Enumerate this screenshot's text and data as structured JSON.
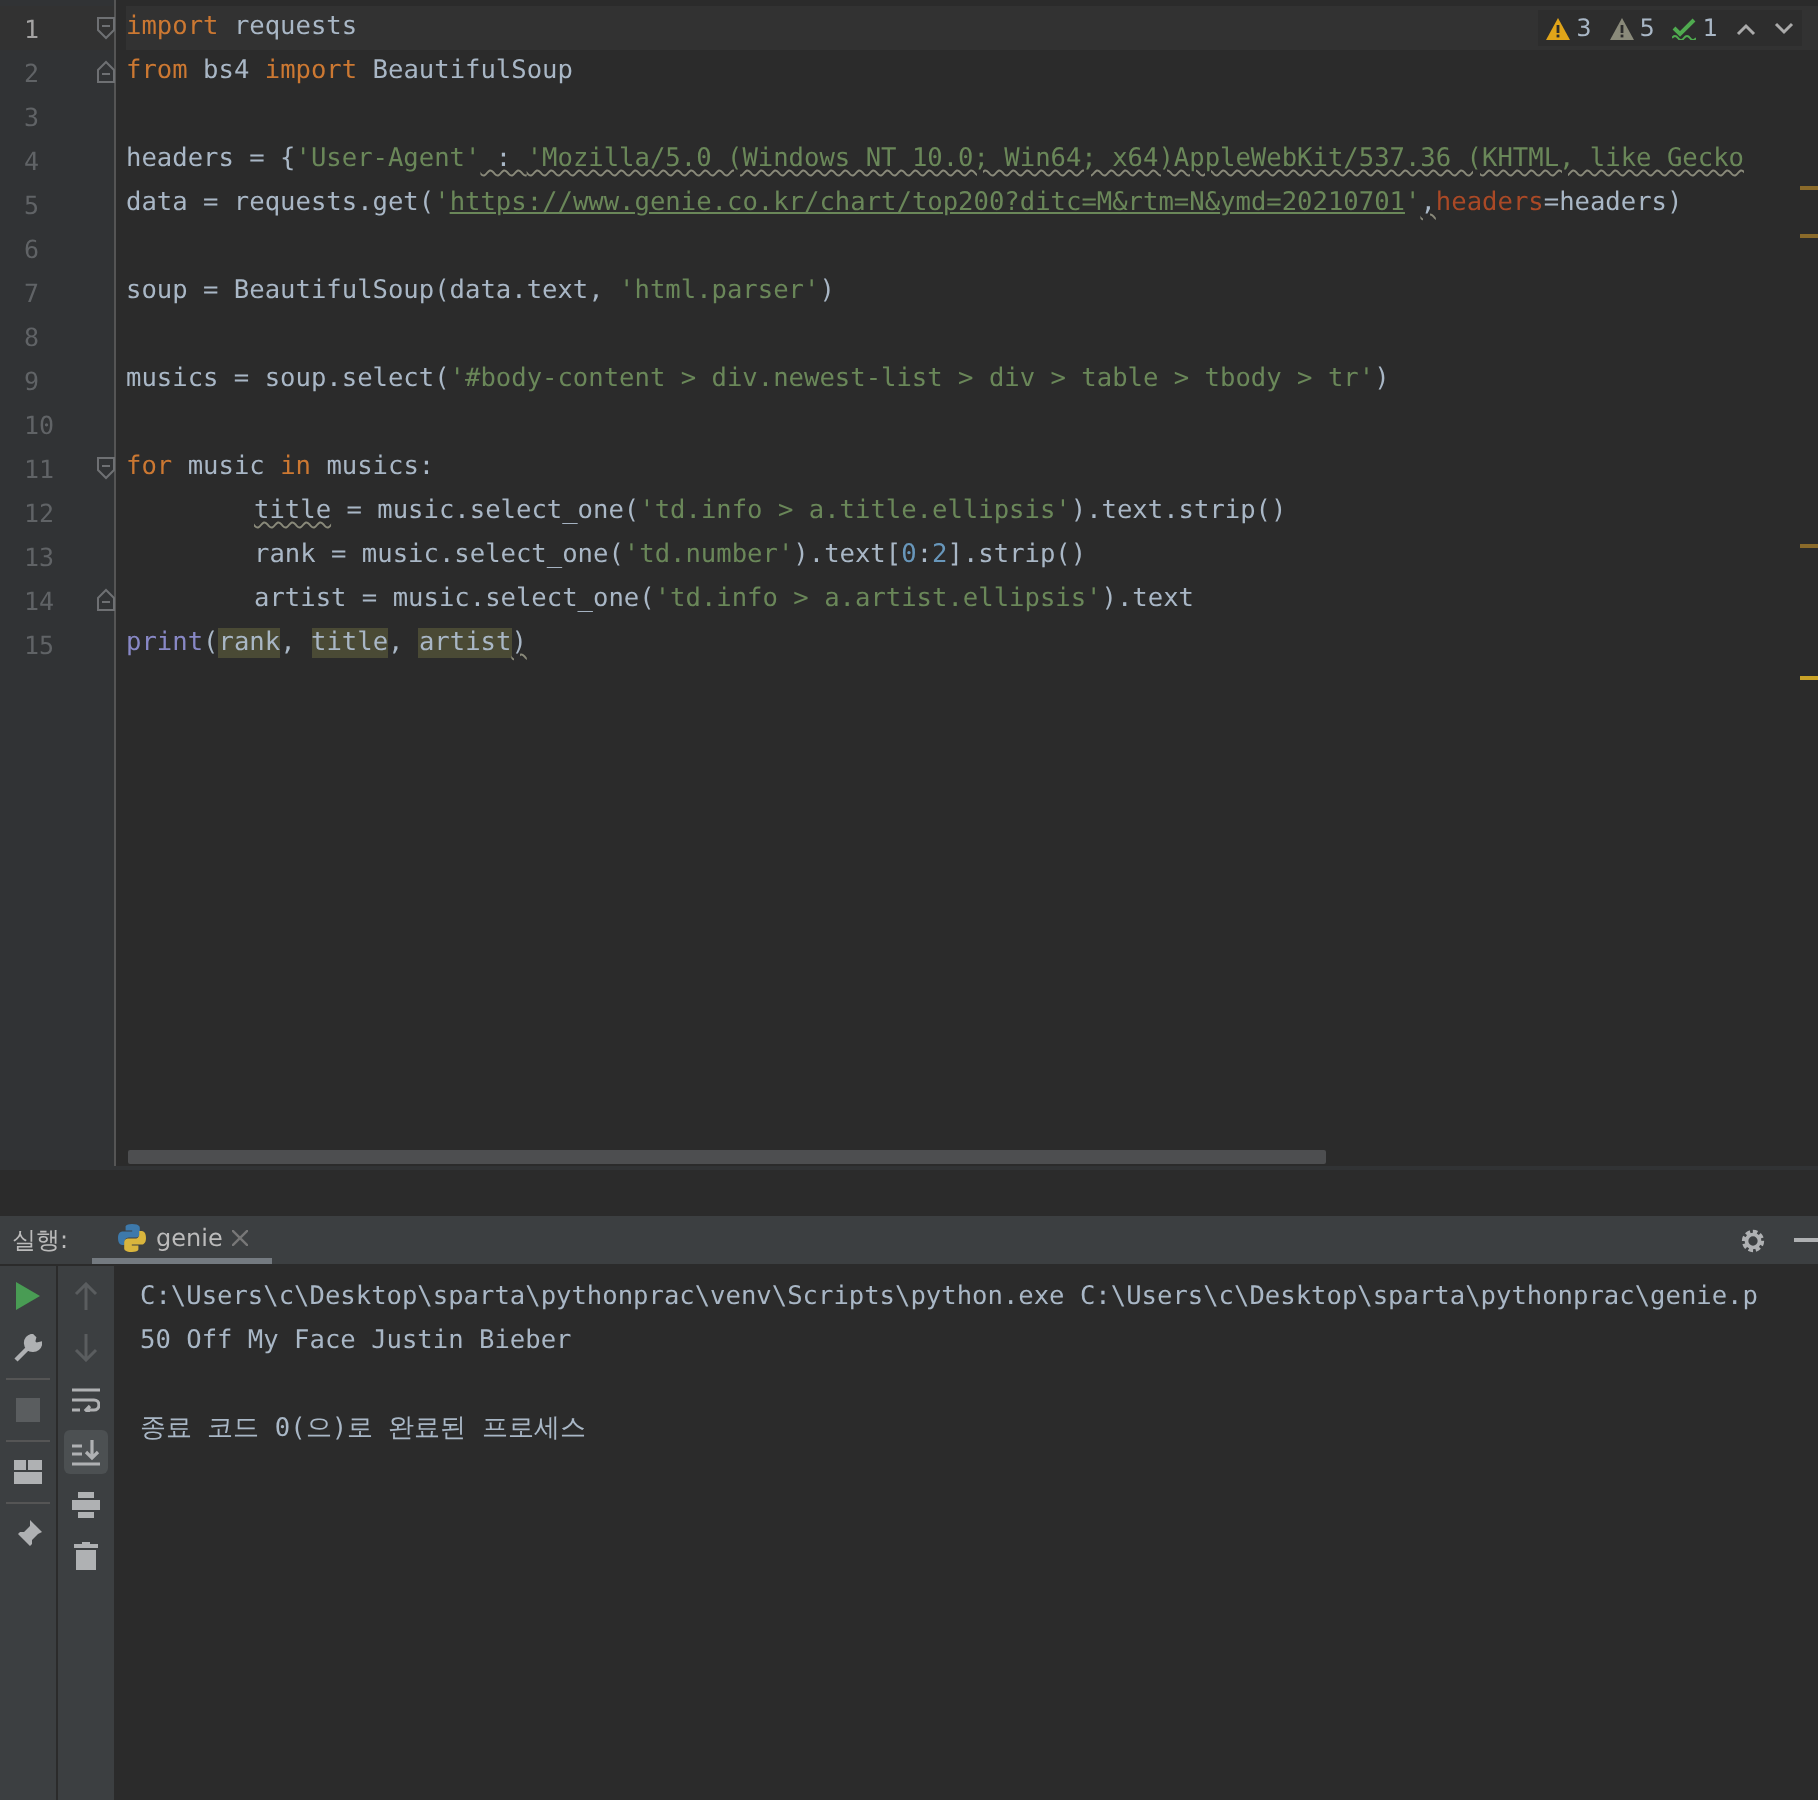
{
  "inspections": [
    {
      "kind": "warning",
      "count": "3"
    },
    {
      "kind": "weak-warning",
      "count": "5"
    },
    {
      "kind": "typo",
      "count": "1"
    }
  ],
  "editor": {
    "lines": [
      {
        "number": "1",
        "current": true,
        "fold_start": true,
        "fold_end": false,
        "tokens": [
          {
            "text": "import",
            "kind": "keyword"
          },
          {
            "text": " requests",
            "kind": "plain"
          }
        ]
      },
      {
        "number": "2",
        "current": false,
        "fold_start": false,
        "fold_end": true,
        "tokens": [
          {
            "text": "from",
            "kind": "keyword"
          },
          {
            "text": " bs4 ",
            "kind": "plain"
          },
          {
            "text": "import",
            "kind": "keyword"
          },
          {
            "text": " BeautifulSoup",
            "kind": "plain"
          }
        ]
      },
      {
        "number": "3",
        "current": false,
        "fold_start": false,
        "fold_end": false
      },
      {
        "number": "4",
        "current": false,
        "fold_start": false,
        "fold_end": false,
        "tokens": [
          {
            "text": "headers = {",
            "kind": "plain"
          },
          {
            "text": "'User-Agent'",
            "kind": "string"
          },
          {
            "text": " : ",
            "kind": "plain",
            "warning": true
          },
          {
            "text": "'Mozilla/5.0 (Windows NT 10.0; Win64; x64)AppleWebKit/537.36 (KHTML, like Gecko",
            "kind": "string",
            "warning": true
          }
        ]
      },
      {
        "number": "5",
        "current": false,
        "fold_start": false,
        "fold_end": false,
        "tokens": [
          {
            "text": "data = requests.get(",
            "kind": "plain"
          },
          {
            "text": "'",
            "kind": "string"
          },
          {
            "text": "https://www.genie.co.kr/chart/top200?ditc=M&rtm=N&ymd=20210701",
            "kind": "url"
          },
          {
            "text": "'",
            "kind": "string"
          },
          {
            "text": ",",
            "kind": "plain",
            "warning": true
          },
          {
            "text": "headers",
            "kind": "param"
          },
          {
            "text": "=headers)",
            "kind": "plain"
          }
        ]
      },
      {
        "number": "6",
        "current": false,
        "fold_start": false,
        "fold_end": false
      },
      {
        "number": "7",
        "current": false,
        "fold_start": false,
        "fold_end": false,
        "tokens": [
          {
            "text": "soup = BeautifulSoup(data.text, ",
            "kind": "plain"
          },
          {
            "text": "'html.parser'",
            "kind": "string"
          },
          {
            "text": ")",
            "kind": "plain"
          }
        ]
      },
      {
        "number": "8",
        "current": false,
        "fold_start": false,
        "fold_end": false
      },
      {
        "number": "9",
        "current": false,
        "fold_start": false,
        "fold_end": false,
        "tokens": [
          {
            "text": "musics = soup.select(",
            "kind": "plain"
          },
          {
            "text": "'#body-content > div.newest-list > div > table > tbody > tr'",
            "kind": "string"
          },
          {
            "text": ")",
            "kind": "plain"
          }
        ]
      },
      {
        "number": "10",
        "current": false,
        "fold_start": false,
        "fold_end": false
      },
      {
        "number": "11",
        "current": false,
        "fold_start": true,
        "fold_end": false,
        "tokens": [
          {
            "text": "for",
            "kind": "keyword"
          },
          {
            "text": " music ",
            "kind": "plain"
          },
          {
            "text": "in",
            "kind": "keyword"
          },
          {
            "text": " musics:",
            "kind": "plain"
          }
        ],
        "children": [
          {
            "number": "12",
            "current": false,
            "fold_start": false,
            "fold_end": false,
            "tokens": [
              {
                "text": "title",
                "kind": "plain",
                "warning": true
              },
              {
                "text": " = music.select_one(",
                "kind": "plain"
              },
              {
                "text": "'td.info > a.title.ellipsis'",
                "kind": "string"
              },
              {
                "text": ").text.strip()",
                "kind": "plain"
              }
            ]
          },
          {
            "number": "13",
            "current": false,
            "fold_start": false,
            "fold_end": false,
            "tokens": [
              {
                "text": "rank = music.select_one(",
                "kind": "plain"
              },
              {
                "text": "'td.number'",
                "kind": "string"
              },
              {
                "text": ").text[",
                "kind": "plain"
              },
              {
                "text": "0",
                "kind": "number"
              },
              {
                "text": ":",
                "kind": "plain"
              },
              {
                "text": "2",
                "kind": "number"
              },
              {
                "text": "].strip()",
                "kind": "plain"
              }
            ]
          },
          {
            "number": "14",
            "current": false,
            "fold_start": false,
            "fold_end": true,
            "tokens": [
              {
                "text": "artist = music.select_one(",
                "kind": "plain"
              },
              {
                "text": "'td.info > a.artist.ellipsis'",
                "kind": "string"
              },
              {
                "text": ").text",
                "kind": "plain"
              }
            ]
          }
        ]
      },
      {
        "number": "15",
        "current": false,
        "fold_start": false,
        "fold_end": false,
        "tokens": [
          {
            "text": "print",
            "kind": "builtin"
          },
          {
            "text": "(",
            "kind": "plain"
          },
          {
            "text": "rank",
            "kind": "usage"
          },
          {
            "text": ", ",
            "kind": "plain"
          },
          {
            "text": "title",
            "kind": "usage"
          },
          {
            "text": ", ",
            "kind": "plain"
          },
          {
            "text": "artist",
            "kind": "usage"
          },
          {
            "text": ")",
            "kind": "plain",
            "warning": true
          }
        ]
      }
    ]
  },
  "run_panel": {
    "label": "실행:",
    "tabs": [
      {
        "title": "genie",
        "selected": true
      }
    ],
    "left_toolbar": [
      {
        "kind": "run",
        "disabled": false
      },
      {
        "kind": "wrench",
        "disabled": false
      },
      {
        "kind": "stop",
        "disabled": true
      },
      {
        "kind": "layout",
        "disabled": false
      },
      {
        "kind": "pin",
        "disabled": false
      }
    ],
    "right_toolbar": [
      {
        "kind": "up",
        "disabled": true,
        "selected": false
      },
      {
        "kind": "down",
        "disabled": true,
        "selected": false
      },
      {
        "kind": "wrap",
        "disabled": false,
        "selected": false
      },
      {
        "kind": "scroll-end",
        "disabled": false,
        "selected": true
      },
      {
        "kind": "print",
        "disabled": false,
        "selected": false
      },
      {
        "kind": "trash",
        "disabled": false,
        "selected": false
      }
    ],
    "console": [
      {
        "kind": "command",
        "text": "C:\\Users\\c\\Desktop\\sparta\\pythonprac\\venv\\Scripts\\python.exe C:\\Users\\c\\Desktop\\sparta\\pythonprac\\genie.p"
      },
      {
        "kind": "output",
        "text": "50 Off My Face Justin Bieber"
      },
      {
        "kind": "exit",
        "text": "종료 코드 0(으)로 완료된 프로세스"
      }
    ]
  }
}
